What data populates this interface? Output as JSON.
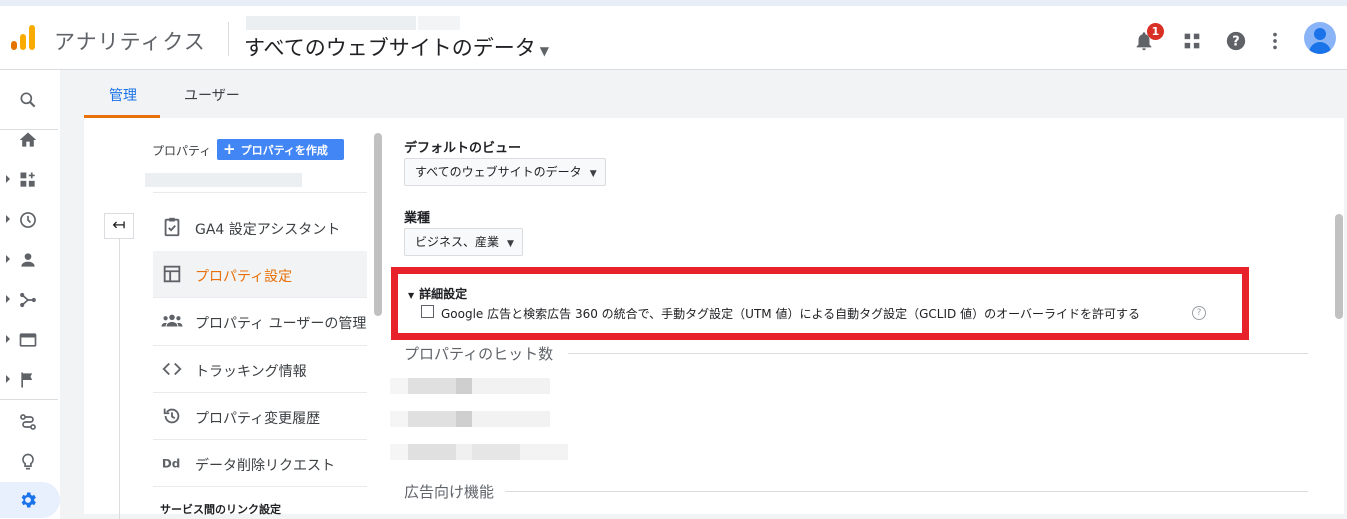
{
  "header": {
    "app_title": "アナリティクス",
    "view_name": "すべてのウェブサイトのデータ",
    "notification_count": "1",
    "colors": {
      "logo_orange": "#f9ab00",
      "logo_dark": "#e37400",
      "badge": "#d93025",
      "accent_blue": "#1a73e8"
    }
  },
  "leftnav": {
    "items": [
      "search-icon",
      "home-icon",
      "customization-icon",
      "realtime-icon",
      "audience-icon",
      "acquisition-icon",
      "behavior-icon",
      "conversions-icon",
      "attribution-icon",
      "discover-icon",
      "admin-gear-icon"
    ]
  },
  "tabs": [
    {
      "label": "管理"
    },
    {
      "label": "ユーザー"
    }
  ],
  "property": {
    "label": "プロパティ",
    "create_button": "プロパティを作成"
  },
  "menu": [
    {
      "label": "GA4 設定アシスタント"
    },
    {
      "label": "プロパティ設定"
    },
    {
      "label": "プロパティ ユーザーの管理"
    },
    {
      "label": "トラッキング情報"
    },
    {
      "label": "プロパティ変更履歴"
    },
    {
      "label": "データ削除リクエスト"
    }
  ],
  "menu_section": "サービス間のリンク設定",
  "settings": {
    "default_view_label": "デフォルトのビュー",
    "default_view_value": "すべてのウェブサイトのデータ",
    "industry_label": "業種",
    "industry_value": "ビジネス、産業",
    "advanced_title": "詳細設定",
    "advanced_checkbox_label": "Google 広告と検索広告 360 の統合で、手動タグ設定（UTM 値）による自動タグ設定（GCLID 値）のオーバーライドを許可する",
    "help_glyph": "?",
    "hits_heading": "プロパティのヒット数",
    "ads_heading": "広告向け機能"
  }
}
